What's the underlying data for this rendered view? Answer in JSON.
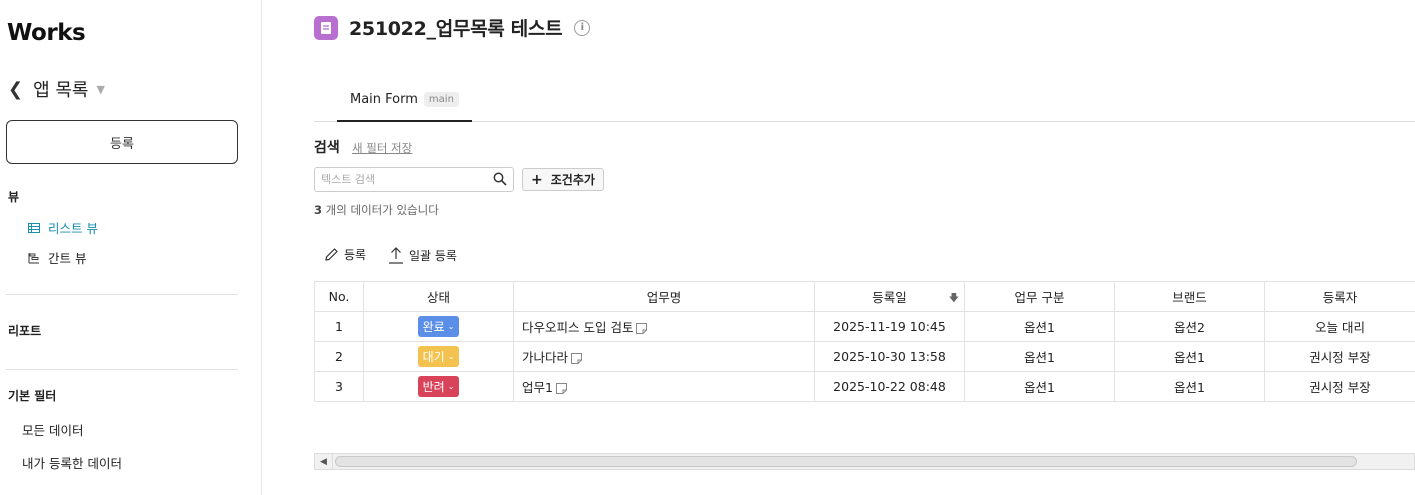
{
  "sidebar": {
    "logo": "Works",
    "app_list_label": "앱 목록",
    "register_label": "등록",
    "views_title": "뷰",
    "views": [
      {
        "label": "리스트 뷰",
        "active": true,
        "icon": "list-view-icon"
      },
      {
        "label": "간트 뷰",
        "active": false,
        "icon": "gantt-view-icon"
      }
    ],
    "report_title": "리포트",
    "filter_title": "기본 필터",
    "filters": [
      "모든 데이터",
      "내가 등록한 데이터"
    ]
  },
  "header": {
    "title": "251022_업무목록 테스트",
    "icon_color": "#b86fd0"
  },
  "tabs": [
    {
      "label": "Main Form",
      "badge": "main",
      "active": true
    }
  ],
  "search": {
    "label": "검색",
    "save_filter": "새 필터 저장",
    "placeholder": "텍스트 검색",
    "add_condition": "조건추가",
    "count_number": "3",
    "count_suffix": " 개의 데이터가 있습니다"
  },
  "toolbar": {
    "register_label": "등록",
    "bulk_register_label": "일괄 등록"
  },
  "table": {
    "columns": [
      "No.",
      "상태",
      "업무명",
      "등록일",
      "업무 구분",
      "브랜드",
      "등록자"
    ],
    "rows": [
      {
        "no": "1",
        "status": "완료",
        "status_color": "#5b8ee6",
        "name": "다우오피스 도입 검토",
        "date": "2025-11-19 10:45",
        "type": "옵션1",
        "brand": "옵션2",
        "author": "오늘 대리"
      },
      {
        "no": "2",
        "status": "대기",
        "status_color": "#f3c24f",
        "name": "가나다라",
        "date": "2025-10-30 13:58",
        "type": "옵션1",
        "brand": "옵션1",
        "author": "권시정 부장"
      },
      {
        "no": "3",
        "status": "반려",
        "status_color": "#d9435a",
        "name": "업무1",
        "date": "2025-10-22 08:48",
        "type": "옵션1",
        "brand": "옵션1",
        "author": "권시정 부장"
      }
    ]
  }
}
